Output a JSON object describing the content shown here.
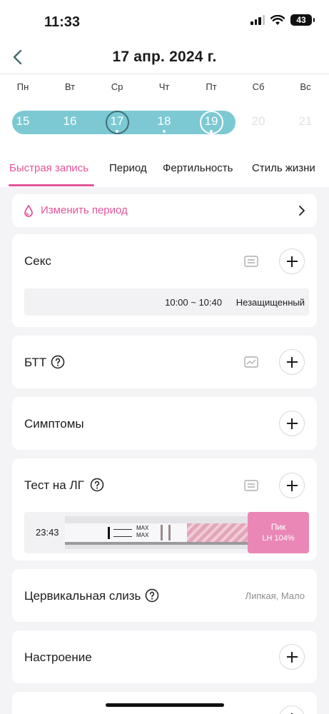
{
  "status_bar": {
    "time": "11:33",
    "battery": "43"
  },
  "header": {
    "title": "17 апр. 2024 г."
  },
  "week": {
    "days": [
      "Пн",
      "Вт",
      "Ср",
      "Чт",
      "Пт",
      "Сб",
      "Вс"
    ],
    "dates": [
      "15",
      "16",
      "17",
      "18",
      "19",
      "20",
      "21"
    ]
  },
  "tabs": [
    {
      "label": "Быстрая запись"
    },
    {
      "label": "Период"
    },
    {
      "label": "Фертильность"
    },
    {
      "label": "Стиль жизни"
    }
  ],
  "period_row": {
    "label": "Изменить период"
  },
  "sex": {
    "title": "Секс",
    "entry_time": "10:00 ~ 10:40",
    "entry_type": "Незащищенный"
  },
  "btt": {
    "title": "БТТ"
  },
  "symptoms": {
    "title": "Симптомы"
  },
  "lh_test": {
    "title": "Тест на ЛГ",
    "time": "23:43",
    "strip_label": "MAX",
    "result_label": "Пик",
    "result_value": "LH 104%",
    "result_color": "#ea87b6"
  },
  "cervical": {
    "title": "Цервикальная слизь",
    "value": "Липкая, Мало"
  },
  "mood": {
    "title": "Настроение"
  },
  "colors": {
    "accent": "#e2559a",
    "calendar_band": "#7cc9d3"
  }
}
